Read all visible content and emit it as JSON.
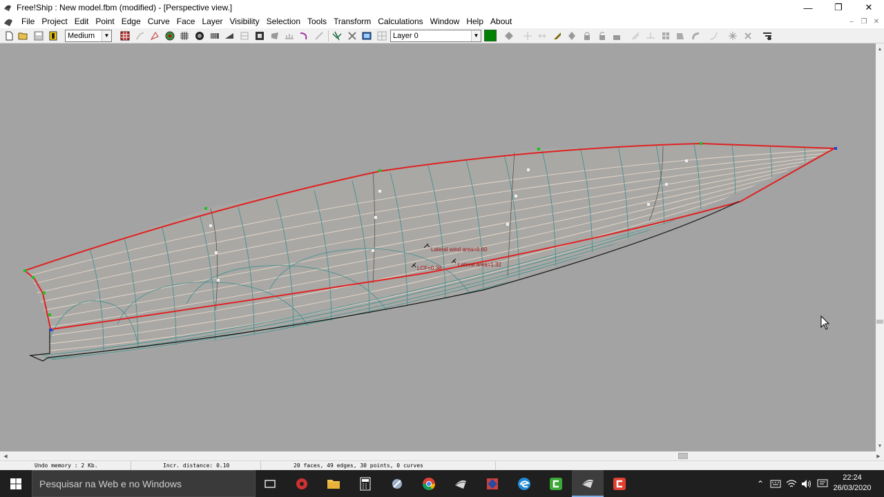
{
  "window": {
    "title": "Free!Ship  : New model.fbm (modified) - [Perspective view.]",
    "minimize_label": "—",
    "restore_label": "❐",
    "close_label": "✕"
  },
  "menu": {
    "items": [
      "File",
      "Project",
      "Edit",
      "Point",
      "Edge",
      "Curve",
      "Face",
      "Layer",
      "Visibility",
      "Selection",
      "Tools",
      "Transform",
      "Calculations",
      "Window",
      "Help",
      "About"
    ]
  },
  "toolbar": {
    "precision_value": "Medium",
    "layer_value": "Layer 0",
    "layer_color": "#008000"
  },
  "viewport": {
    "background": "#a3a3a3",
    "annotations": {
      "wind": "Lateral wind area=6.60",
      "lateral": "Lateral area=1.32",
      "lcf": "LCF=0.38"
    }
  },
  "statusbar": {
    "undo": "Undo memory : 2 Kb.",
    "incr": "Incr. distance: 0.10",
    "counts": "20 faces, 49 edges, 30 points, 0 curves"
  },
  "taskbar": {
    "search_placeholder": "Pesquisar na Web e no Windows",
    "time": "22:24",
    "date": "26/03/2020"
  }
}
